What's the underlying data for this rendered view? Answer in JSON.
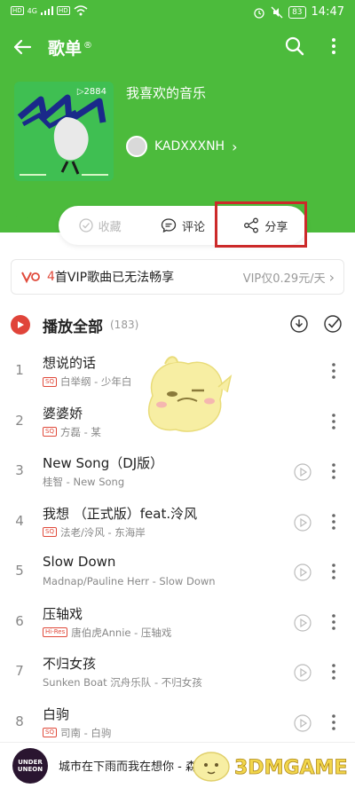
{
  "status_bar": {
    "tags": [
      "HD",
      "HD"
    ],
    "signal": "4G",
    "battery": "83",
    "time": "14:47"
  },
  "header": {
    "title": "歌单",
    "title_mark": "®"
  },
  "playlist": {
    "name": "我喜欢的音乐",
    "play_count": "▷2884",
    "creator": "KADXXXNH",
    "creator_chevron": "›"
  },
  "actions": {
    "collect": "收藏",
    "comment": "评论",
    "share": "分享"
  },
  "vip_banner": {
    "count": "4",
    "text": "首VIP歌曲已无法畅享",
    "price": "VIP仅0.29元/天",
    "chevron": "›"
  },
  "play_all": {
    "label": "播放全部",
    "count": "(183)"
  },
  "songs": [
    {
      "index": "1",
      "title": "想说的话",
      "badge": "SQ",
      "subtitle": "白举纲 - 少年白"
    },
    {
      "index": "2",
      "title": "婆婆娇",
      "badge": "SQ",
      "subtitle": "方磊 - 某"
    },
    {
      "index": "3",
      "title": "New Song（DJ版）",
      "badge": "",
      "subtitle": "桂智 - New Song"
    },
    {
      "index": "4",
      "title": "我想 （正式版）feat.泠风",
      "badge": "SQ",
      "subtitle": "法老/泠风 - 东海岸"
    },
    {
      "index": "5",
      "title": "Slow Down",
      "badge": "",
      "subtitle": "Madnap/Pauline Herr - Slow Down"
    },
    {
      "index": "6",
      "title": "压轴戏",
      "badge": "Hi-Res",
      "subtitle": "唐伯虎Annie - 压轴戏"
    },
    {
      "index": "7",
      "title": "不归女孩",
      "badge": "",
      "subtitle": "Sunken Boat 沉舟乐队 - 不归女孩"
    },
    {
      "index": "8",
      "title": "白驹",
      "badge": "SQ",
      "subtitle": "司南 - 白驹"
    }
  ],
  "mini_player": {
    "cover_text": "UNDER UNEON",
    "title": "城市在下雨而我在想你 - 森"
  },
  "watermark": "3DMGAME",
  "colors": {
    "header_green": "#4cbb3c",
    "accent_red": "#e04a3b",
    "highlight_box": "#cc2a2a"
  }
}
